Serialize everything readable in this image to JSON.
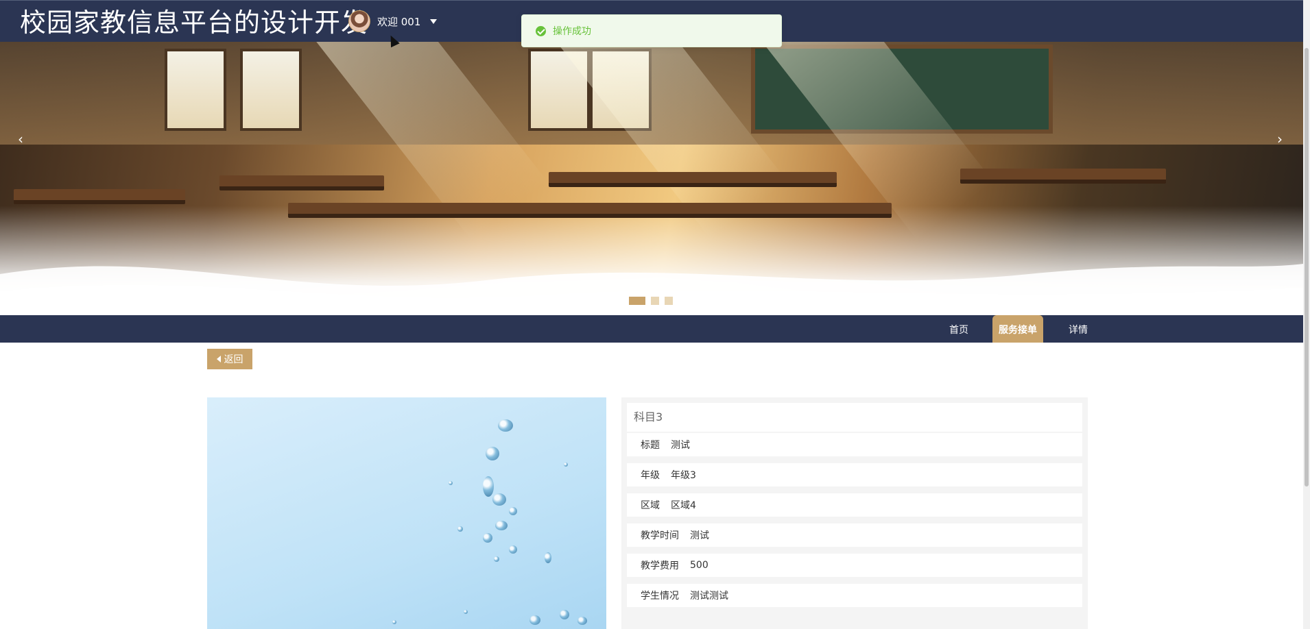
{
  "header": {
    "title": "校园家教信息平台的设计开发",
    "welcome": "欢迎 001"
  },
  "toast": {
    "message": "操作成功"
  },
  "banner": {
    "prev": "‹",
    "next": "›",
    "slides": 3,
    "active_slide": 1
  },
  "nav": {
    "items": [
      {
        "label": "首页"
      },
      {
        "label": "服务接单"
      },
      {
        "label": "详情"
      }
    ],
    "active": "服务接单"
  },
  "back_label": "返回",
  "detail": {
    "title": "科目3",
    "rows": [
      {
        "label": "标题",
        "value": "测试"
      },
      {
        "label": "年级",
        "value": "年级3"
      },
      {
        "label": "区域",
        "value": "区域4"
      },
      {
        "label": "教学时间",
        "value": "测试"
      },
      {
        "label": "教学费用",
        "value": "500"
      },
      {
        "label": "学生情况",
        "value": "测试测试"
      }
    ]
  },
  "colors": {
    "header_bg": "#2b3553",
    "accent": "#c9a36a",
    "success": "#67c23a"
  }
}
